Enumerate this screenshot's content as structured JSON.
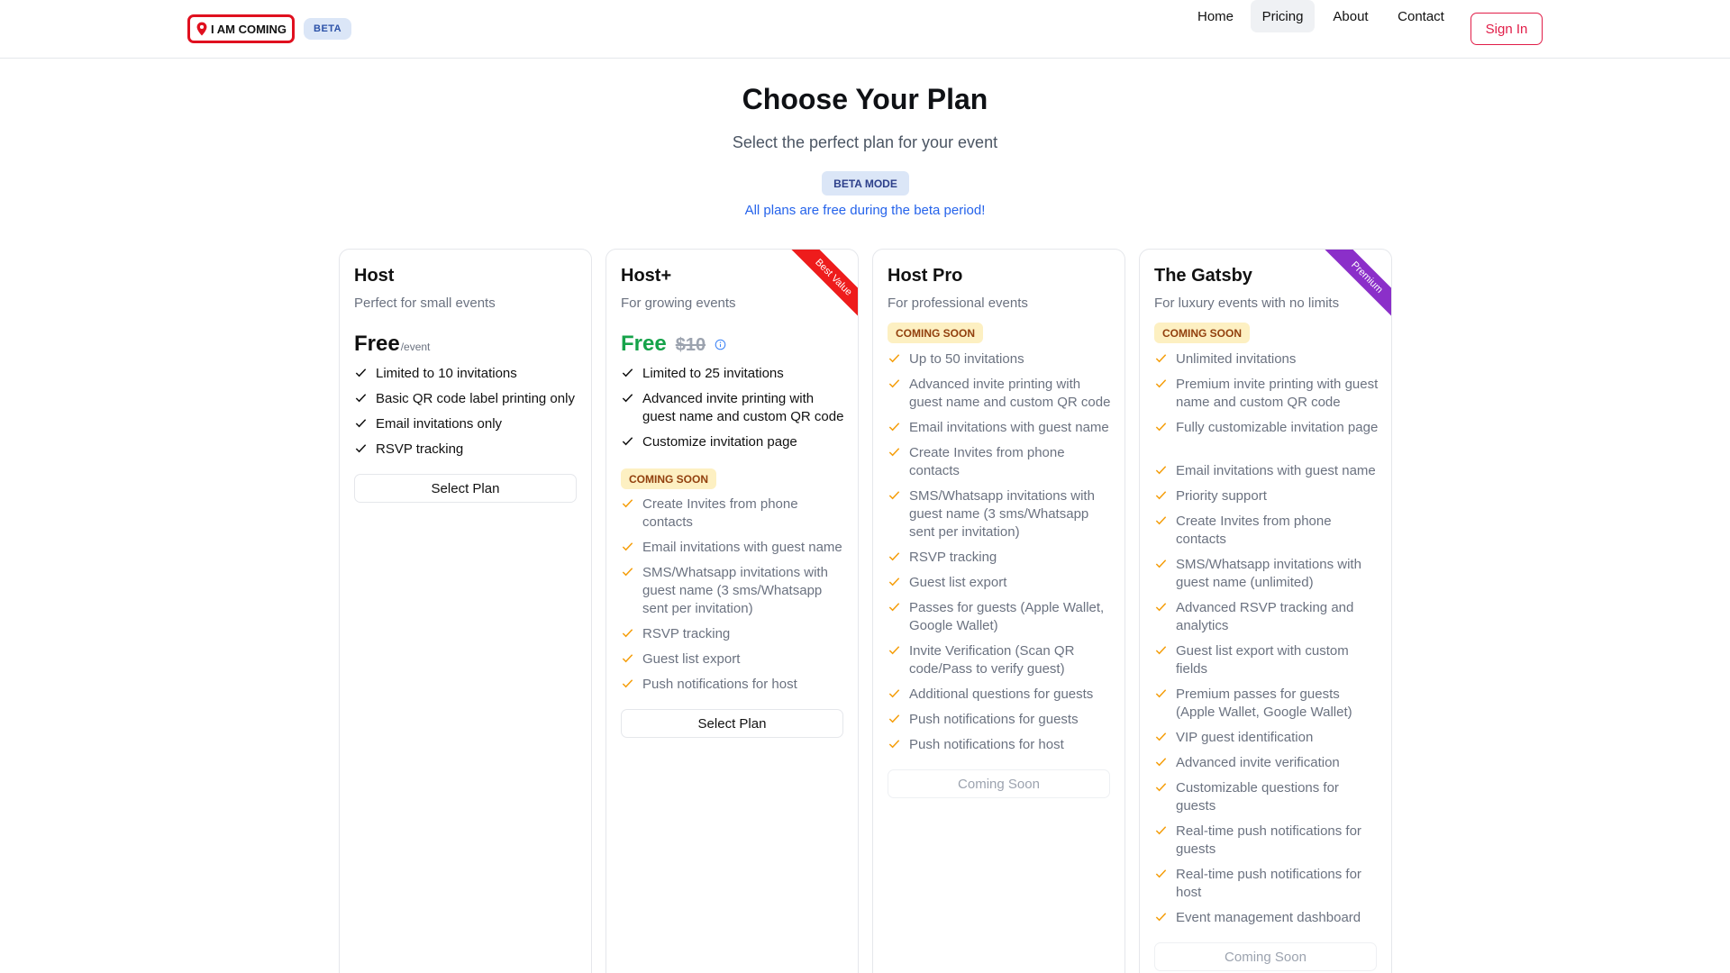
{
  "header": {
    "logo_text": "I AM COMING",
    "beta_badge": "BETA",
    "nav": [
      "Home",
      "Pricing",
      "About",
      "Contact"
    ],
    "signin": "Sign In"
  },
  "hero": {
    "title": "Choose Your Plan",
    "subtitle": "Select the perfect plan for your event",
    "beta_mode": "BETA MODE",
    "beta_note": "All plans are free during the beta period!"
  },
  "plans": [
    {
      "name": "Host",
      "desc": "Perfect for small events",
      "price": "Free",
      "unit": "/event",
      "features": [
        "Limited to 10 invitations",
        "Basic QR code label printing only",
        "Email invitations only",
        "RSVP tracking"
      ],
      "button": "Select Plan"
    },
    {
      "name": "Host+",
      "desc": "For growing events",
      "price": "Free",
      "old_price": "$10",
      "ribbon": "Best Value",
      "features": [
        "Limited to 25 invitations",
        "Advanced invite printing with guest name and custom QR code",
        "Customize invitation page"
      ],
      "coming_badge": "COMING SOON",
      "coming_features": [
        "Create Invites from phone contacts",
        "Email invitations with guest name",
        "SMS/Whatsapp invitations with guest name (3 sms/Whatsapp sent per invitation)",
        "RSVP tracking",
        "Guest list export",
        "Push notifications for host"
      ],
      "button": "Select Plan"
    },
    {
      "name": "Host Pro",
      "desc": "For professional events",
      "coming_badge": "COMING SOON",
      "features": [
        "Up to 50 invitations",
        "Advanced invite printing with guest name and custom QR code",
        "Email invitations with guest name",
        "Create Invites from phone contacts",
        "SMS/Whatsapp invitations with guest name (3 sms/Whatsapp sent per invitation)",
        "RSVP tracking",
        "Guest list export",
        "Passes for guests (Apple Wallet, Google Wallet)",
        "Invite Verification (Scan QR code/Pass to verify guest)",
        "Additional questions for guests",
        "Push notifications for guests",
        "Push notifications for host"
      ],
      "button": "Coming Soon"
    },
    {
      "name": "The Gatsby",
      "desc": "For luxury events with no limits",
      "coming_badge": "COMING SOON",
      "ribbon": "Premium",
      "features": [
        "Unlimited invitations",
        "Premium invite printing with guest name and custom QR code",
        "Fully customizable invitation page",
        "Email invitations with guest name",
        "Priority support",
        "Create Invites from phone contacts",
        "SMS/Whatsapp invitations with guest name (unlimited)",
        "Advanced RSVP tracking and analytics",
        "Guest list export with custom fields",
        "Premium passes for guests (Apple Wallet, Google Wallet)",
        "VIP guest identification",
        "Advanced invite verification",
        "Customizable questions for guests",
        "Real-time push notifications for guests",
        "Real-time push notifications for host",
        "Event management dashboard"
      ],
      "button": "Coming Soon"
    }
  ],
  "colors": {
    "brand_red": "#e0101f",
    "check_orange": "#f59e0b",
    "free_green": "#16a34a",
    "beta_blue": "#2563eb",
    "ribbon_red": "#ee1c1c",
    "ribbon_purple": "#8b2fc9"
  }
}
